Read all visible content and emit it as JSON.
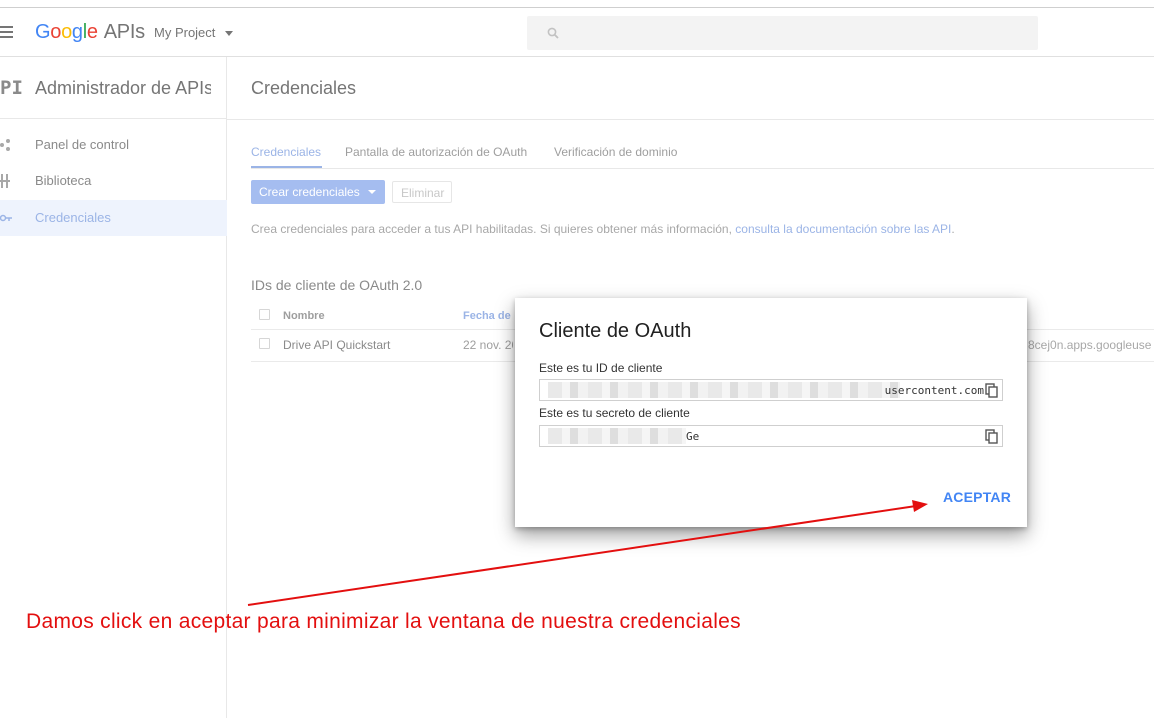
{
  "topbar": {
    "logo_letters": [
      "G",
      "o",
      "o",
      "g",
      "l",
      "e"
    ],
    "logo_suffix": "APIs",
    "project": "My Project"
  },
  "sidebar": {
    "badge": "PI",
    "title": "Administrador de APIs",
    "items": [
      {
        "label": "Panel de control",
        "icon": "dashboard-icon"
      },
      {
        "label": "Biblioteca",
        "icon": "library-icon"
      },
      {
        "label": "Credenciales",
        "icon": "key-icon",
        "active": true
      }
    ]
  },
  "main": {
    "title": "Credenciales",
    "tabs": [
      {
        "label": "Credenciales",
        "active": true
      },
      {
        "label": "Pantalla de autorización de OAuth"
      },
      {
        "label": "Verificación de dominio"
      }
    ],
    "create_button": "Crear credenciales",
    "delete_button": "Eliminar",
    "info_text": "Crea credenciales para acceder a tus API habilitadas. Si quieres obtener más información, ",
    "info_link": "consulta la documentación sobre las API",
    "info_end": ".",
    "section_title": "IDs de cliente de OAuth 2.0",
    "table": {
      "headers": {
        "name": "Nombre",
        "date": "Fecha de"
      },
      "rows": [
        {
          "name": "Drive API Quickstart",
          "date": "22 nov. 20",
          "client_id": "8cej0n.apps.googleuse"
        }
      ]
    }
  },
  "dialog": {
    "title": "Cliente de OAuth",
    "client_id_label": "Este es tu ID de cliente",
    "client_id_value": "usercontent.com",
    "secret_label": "Este es tu secreto de cliente",
    "secret_value": "Ge",
    "accept_button": "ACEPTAR"
  },
  "annotation": {
    "text": "Damos click en aceptar para minimizar la ventana de nuestra credenciales",
    "color": "#e30f0f"
  },
  "colors": {
    "accent": "#4285f4",
    "dimmed_accent": "#9bb4e6"
  }
}
